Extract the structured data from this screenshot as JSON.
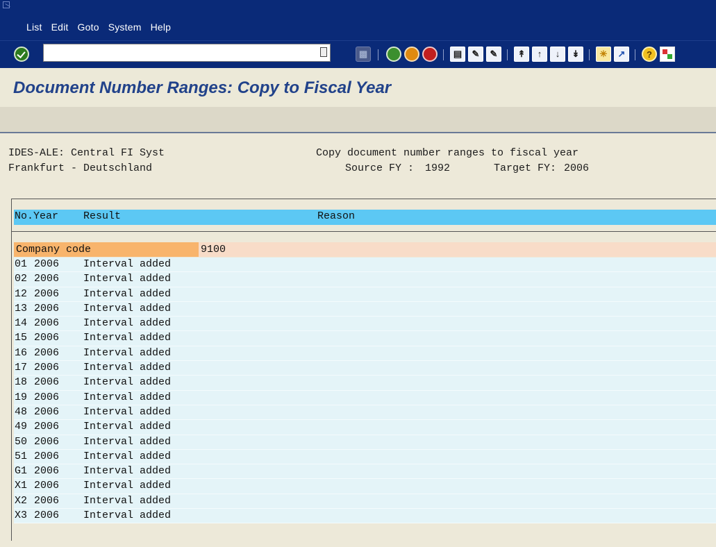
{
  "menu": [
    "List",
    "Edit",
    "Goto",
    "System",
    "Help"
  ],
  "command_field": {
    "value": ""
  },
  "title": "Document Number Ranges: Copy to Fiscal Year",
  "header": {
    "left_line1": "IDES-ALE: Central FI Syst",
    "left_line2": "Frankfurt - Deutschland",
    "right_line1": "Copy document number ranges to fiscal year",
    "source_label": "Source FY :",
    "source_value": "1992",
    "target_label": "Target FY:",
    "target_value": "2006"
  },
  "columns": {
    "no_year": "No.Year",
    "result": "Result",
    "reason": "Reason"
  },
  "group": {
    "label": "Company code",
    "value": "9100"
  },
  "rows": [
    {
      "no": "01",
      "year": "2006",
      "result": "Interval added"
    },
    {
      "no": "02",
      "year": "2006",
      "result": "Interval added"
    },
    {
      "no": "12",
      "year": "2006",
      "result": "Interval added"
    },
    {
      "no": "13",
      "year": "2006",
      "result": "Interval added"
    },
    {
      "no": "14",
      "year": "2006",
      "result": "Interval added"
    },
    {
      "no": "15",
      "year": "2006",
      "result": "Interval added"
    },
    {
      "no": "16",
      "year": "2006",
      "result": "Interval added"
    },
    {
      "no": "17",
      "year": "2006",
      "result": "Interval added"
    },
    {
      "no": "18",
      "year": "2006",
      "result": "Interval added"
    },
    {
      "no": "19",
      "year": "2006",
      "result": "Interval added"
    },
    {
      "no": "48",
      "year": "2006",
      "result": "Interval added"
    },
    {
      "no": "49",
      "year": "2006",
      "result": "Interval added"
    },
    {
      "no": "50",
      "year": "2006",
      "result": "Interval added"
    },
    {
      "no": "51",
      "year": "2006",
      "result": "Interval added"
    },
    {
      "no": "G1",
      "year": "2006",
      "result": "Interval added"
    },
    {
      "no": "X1",
      "year": "2006",
      "result": "Interval added"
    },
    {
      "no": "X2",
      "year": "2006",
      "result": "Interval added"
    },
    {
      "no": "X3",
      "year": "2006",
      "result": "Interval added"
    }
  ],
  "colors": {
    "menubar": "#0a2a78",
    "column_header": "#5cc8f4",
    "group_label": "#f8b46c",
    "row": "#e4f4f8",
    "title": "#21428a"
  }
}
